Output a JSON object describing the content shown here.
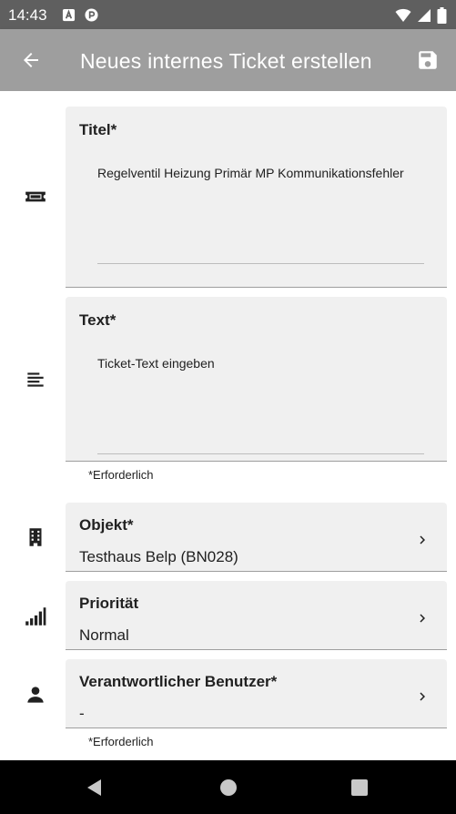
{
  "status_bar": {
    "time": "14:43",
    "notification_icons": [
      "a-icon",
      "p-icon"
    ],
    "system_icons": [
      "wifi-icon",
      "signal-icon",
      "battery-icon"
    ]
  },
  "app_bar": {
    "title": "Neues internes Ticket erstellen",
    "back_icon": "arrow-left-icon",
    "save_icon": "floppy-disk-icon"
  },
  "form": {
    "title_field": {
      "label": "Titel*",
      "value": "Regelventil Heizung Primär MP Kommunikationsfehler",
      "icon": "ticket-icon"
    },
    "text_field": {
      "label": "Text*",
      "placeholder": "Ticket-Text eingeben",
      "icon": "text-lines-icon"
    },
    "helper_1": "*Erforderlich",
    "object_field": {
      "label": "Objekt*",
      "value": "Testhaus Belp (BN028)",
      "icon": "building-icon"
    },
    "priority_field": {
      "label": "Priorität",
      "value": "Normal",
      "icon": "signal-bars-icon"
    },
    "responsible_field": {
      "label": "Verantwortlicher Benutzer*",
      "value": "-",
      "icon": "person-icon"
    },
    "helper_2": "*Erforderlich"
  },
  "nav_bar": {
    "buttons": [
      "back-triangle-icon",
      "home-circle-icon",
      "recents-square-icon"
    ]
  },
  "colors": {
    "status_bar": "#5f5f5f",
    "app_bar": "#9e9e9e",
    "field_bg": "#f0f0f0",
    "nav_bar": "#000000"
  }
}
